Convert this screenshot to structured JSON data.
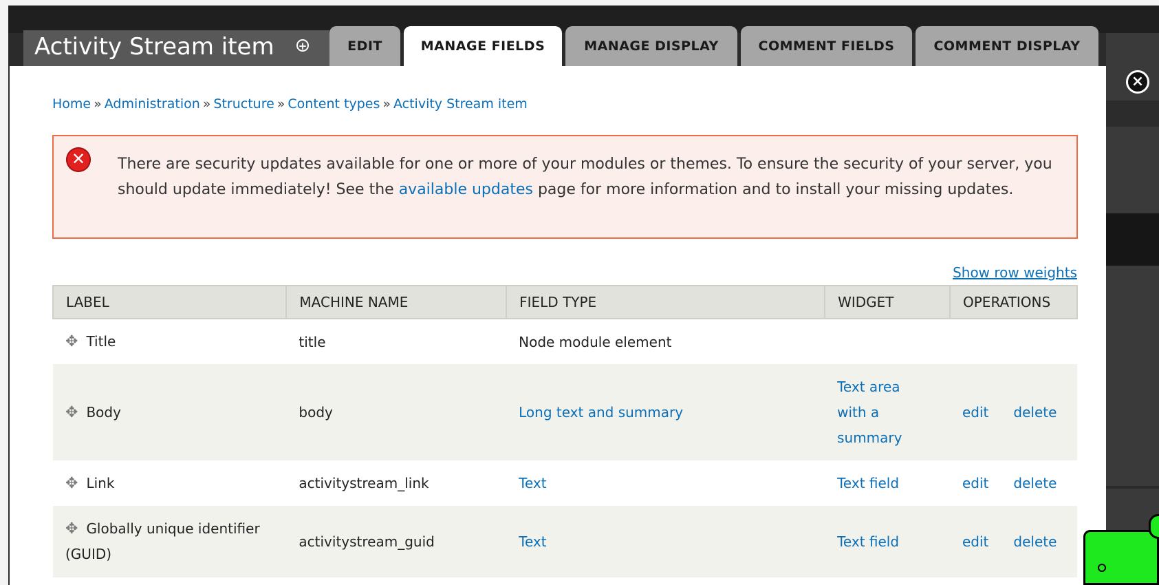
{
  "header": {
    "title": "Activity Stream item",
    "tabs": [
      {
        "label": "EDIT",
        "active": false
      },
      {
        "label": "MANAGE FIELDS",
        "active": true
      },
      {
        "label": "MANAGE DISPLAY",
        "active": false
      },
      {
        "label": "COMMENT FIELDS",
        "active": false
      },
      {
        "label": "COMMENT DISPLAY",
        "active": false
      }
    ]
  },
  "breadcrumb": [
    {
      "label": "Home"
    },
    {
      "label": "Administration"
    },
    {
      "label": "Structure"
    },
    {
      "label": "Content types"
    },
    {
      "label": "Activity Stream item"
    }
  ],
  "breadcrumb_separator": "»",
  "alert": {
    "text_before": "There are security updates available for one or more of your modules or themes. To ensure the security of your server, you should update immediately! See the ",
    "link": "available updates",
    "text_after": " page for more information and to install your missing updates."
  },
  "show_row_weights": "Show row weights",
  "table": {
    "headers": [
      "LABEL",
      "MACHINE NAME",
      "FIELD TYPE",
      "WIDGET",
      "OPERATIONS"
    ],
    "rows": [
      {
        "label": "Title",
        "machine_name": "title",
        "field_type": "Node module element",
        "field_type_link": false,
        "widget": "",
        "edit": "",
        "delete": ""
      },
      {
        "label": "Body",
        "machine_name": "body",
        "field_type": "Long text and summary",
        "field_type_link": true,
        "widget": "Text area with a summary",
        "edit": "edit",
        "delete": "delete"
      },
      {
        "label": "Link",
        "machine_name": "activitystream_link",
        "field_type": "Text",
        "field_type_link": true,
        "widget": "Text field",
        "edit": "edit",
        "delete": "delete"
      },
      {
        "label": "Globally unique identifier (GUID)",
        "machine_name": "activitystream_guid",
        "field_type": "Text",
        "field_type_link": true,
        "widget": "Text field",
        "edit": "edit",
        "delete": "delete"
      }
    ]
  },
  "colors": {
    "link": "#0b6fb8",
    "alert_border": "#ed6b45",
    "alert_bg": "#fcefeb",
    "error_icon": "#e22020"
  }
}
